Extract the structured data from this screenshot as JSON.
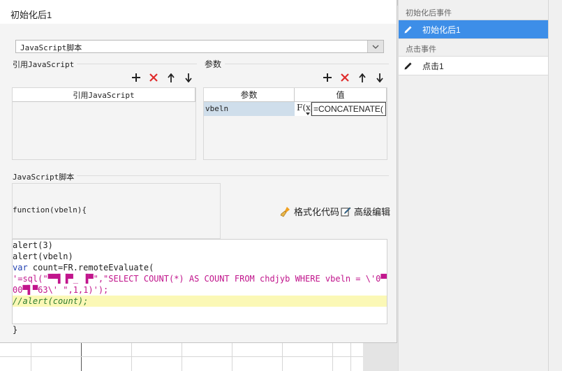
{
  "dialog": {
    "title": "初始化后1",
    "close_icon": "close-icon"
  },
  "script_type_select": {
    "value": "JavaScript脚本"
  },
  "referenced_js": {
    "section_label": "引用JavaScript",
    "column_header": "引用JavaScript"
  },
  "params": {
    "section_label": "参数",
    "column_headers": [
      "参数",
      "值"
    ],
    "rows": [
      {
        "name": "vbeln",
        "formula_badge": "F(x)",
        "value": "=CONCATENATE("
      }
    ]
  },
  "toolbar": {
    "add_icon": "plus-icon",
    "delete_icon": "x-icon",
    "up_icon": "arrow-up-icon",
    "down_icon": "arrow-down-icon"
  },
  "script": {
    "section_label": "JavaScript脚本",
    "signature": "function(vbeln){",
    "format_code_label": "格式化代码",
    "advanced_edit_label": "高级编辑",
    "code": {
      "line1": "alert(3)",
      "line2": "alert(vbeln)",
      "line3_kw": "var",
      "line3_rest": " count=FR.remoteEvaluate(",
      "line4": "'=sql(\"▀▀▌▐▀_ ▐▀\",\"SELECT COUNT(*) AS COUNT FROM chdjyb WHERE vbeln = \\'0▀▀",
      "line5": "00▀▌▀63\\' \",1,1)');",
      "line6": "//alert(count);"
    },
    "closing_brace": "}"
  },
  "events_panel": {
    "group1_label": "初始化后事件",
    "group1_item": "初始化后1",
    "group2_label": "点击事件",
    "group2_item": "点击1",
    "item_icon": "pencil-icon"
  },
  "colors": {
    "selected_event_bg": "#3d8ee8",
    "param_selected_bg": "#cfdeeb",
    "comment_highlight": "#fbf8b6"
  }
}
